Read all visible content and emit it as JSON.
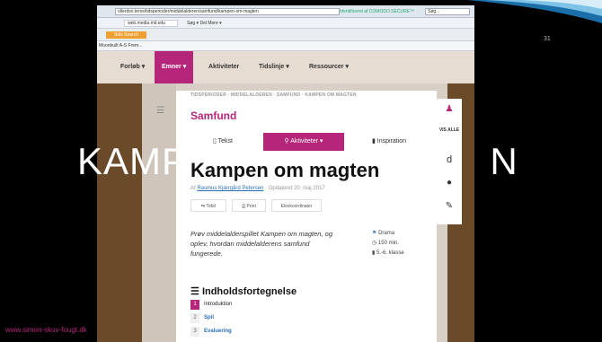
{
  "slide": {
    "number": "31",
    "big_title_left": "KAMP",
    "big_title_right": "N",
    "credit": "www.simon-skov-fougt.dk"
  },
  "browser": {
    "url": "ollerdsn.tems/tidsperioder/middelalderen/samfund/kampen-om-magten",
    "cert": "Identificeret af COMODO SECURE™",
    "search": "Søg...",
    "tab": "web.media.mit.edu",
    "menu": "Søg ▾   Del   More ▾",
    "sidsearch": "Sids Search",
    "favorites": "Moonbuilt A-S Frem...",
    "share": "Rel"
  },
  "nav": {
    "items": [
      "Forløb ▾",
      "Emner ▾",
      "Aktiviteter",
      "Tidslinje ▾",
      "Ressourcer ▾"
    ]
  },
  "page": {
    "breadcrumb": "TIDSPERIODER · MIDDELALDEREN · SAMFUND · KAMPEN OM MAGTEN",
    "subject": "Samfund",
    "tabs": [
      "Tekst",
      "Aktiviteter ▾",
      "Inspiration"
    ],
    "title": "Kampen om magten",
    "byline_prefix": "Af",
    "author": "Rasmus Kjærgård Petersen",
    "updated": "· Opdateret 20. maj 2017",
    "buttons": [
      "Tidel",
      "Print",
      "Elevkoordinater"
    ],
    "intro": "Prøv middelalderspillet Kampen om magten, og oplev, hvordan middelalderens samfund fungerede.",
    "meta": [
      "Drama",
      "150 min.",
      "5.-6. klasse"
    ],
    "toc_title": "Indholdsfortegnelse",
    "toc": [
      {
        "n": "1",
        "label": "Introduktion"
      },
      {
        "n": "2",
        "label": "Spil"
      },
      {
        "n": "3",
        "label": "Evaluering"
      }
    ]
  },
  "sidebar": {
    "vis_alle": "VIS ALLE",
    "letter_d": "d"
  }
}
